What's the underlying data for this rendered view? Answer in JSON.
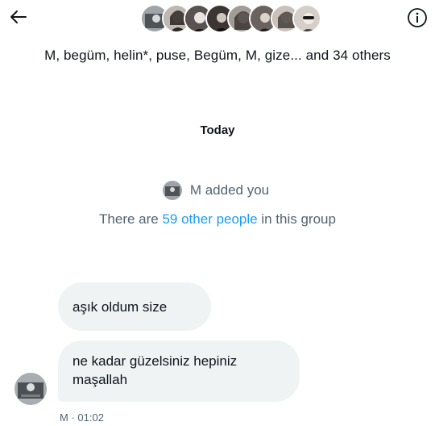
{
  "header": {
    "back_icon": "arrow-left-icon",
    "info_icon": "info-circle-icon",
    "avatar_count_shown": 8,
    "group_name": "M, begüm, helin*, puse, Begüm, M, gize... and 34 others"
  },
  "conversation": {
    "date_label": "Today",
    "system_added": "M added you",
    "group_info": {
      "prefix": "There are ",
      "link": "59 other people",
      "suffix": " in this group"
    }
  },
  "messages": [
    {
      "text": "aşık oldum size"
    },
    {
      "lines": [
        "ne kadar güzelsiniz hepiniz",
        "maşallah"
      ]
    }
  ],
  "meta": {
    "sender": "M",
    "separator": " · ",
    "time": "01:02"
  },
  "colors": {
    "accent": "#1d9bf0",
    "muted": "#536471",
    "bubble": "#eff3f4",
    "text": "#0f1419"
  }
}
